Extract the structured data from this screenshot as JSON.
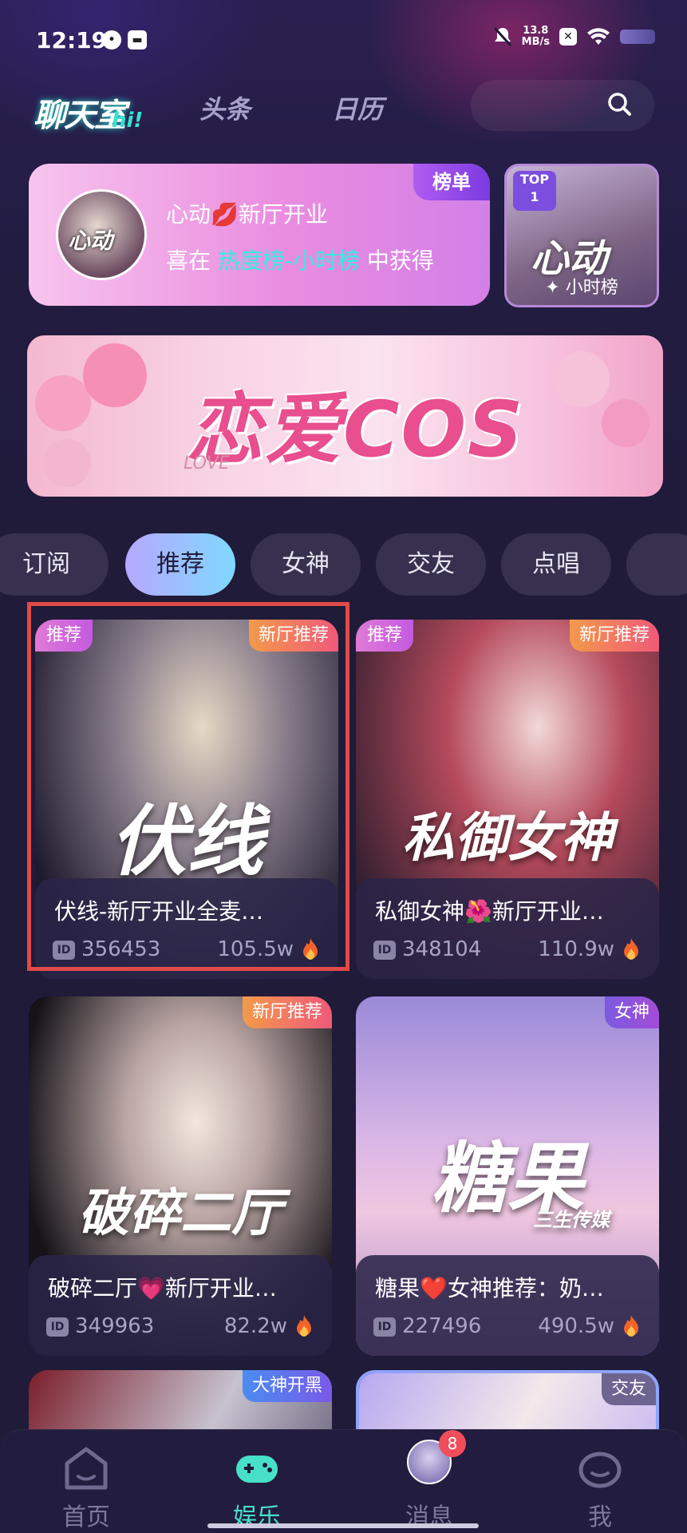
{
  "status_bar": {
    "time": "12:19",
    "net_speed_value": "13.8",
    "net_speed_unit": "MB/s"
  },
  "header": {
    "logo_text": "聊天室",
    "logo_hi": "hi!",
    "tabs": [
      "头条",
      "日历"
    ]
  },
  "ranking": {
    "title": "心动💋新厅开业",
    "subtitle_pre": "喜在 ",
    "subtitle_highlight": "热度榜-小时榜",
    "subtitle_post": " 中获得",
    "tag": "榜单",
    "avatar_text": "心动",
    "top_badge_line1": "TOP",
    "top_badge_line2": "1",
    "top_art": "心动",
    "top_label": "小时榜"
  },
  "banner": {
    "title": "恋爱COS",
    "sub": "LOVE"
  },
  "categories": [
    "订阅",
    "推荐",
    "女神",
    "交友",
    "点唱"
  ],
  "active_category": "推荐",
  "rooms": [
    {
      "big": "伏线",
      "name": "伏线-新厅开业全麦…",
      "id": "356453",
      "heat": "105.5w",
      "tag_left": "推荐",
      "tag_right": "新厅推荐"
    },
    {
      "big": "私御女神",
      "name": "私御女神🌺新厅开业…",
      "id": "348104",
      "heat": "110.9w",
      "tag_left": "推荐",
      "tag_right": "新厅推荐"
    },
    {
      "big": "破碎二厅",
      "name": "破碎二厅💗新厅开业…",
      "id": "349963",
      "heat": "82.2w",
      "tag_right": "新厅推荐"
    },
    {
      "big": "糖果",
      "big_sub": "三生传媒",
      "name": "糖果❤️女神推荐：奶…",
      "id": "227496",
      "heat": "490.5w",
      "tag_right": "女神"
    },
    {
      "tag_right": "大神开黑"
    },
    {
      "tag_right": "交友"
    }
  ],
  "id_label": "ID",
  "bottom_nav": {
    "items": [
      "首页",
      "娱乐",
      "消息",
      "我"
    ],
    "active": "娱乐",
    "message_badge": "8"
  },
  "colors": {
    "background": "#1f1b38",
    "accent_teal": "#48e0c8",
    "highlight_red": "#e14a48"
  }
}
